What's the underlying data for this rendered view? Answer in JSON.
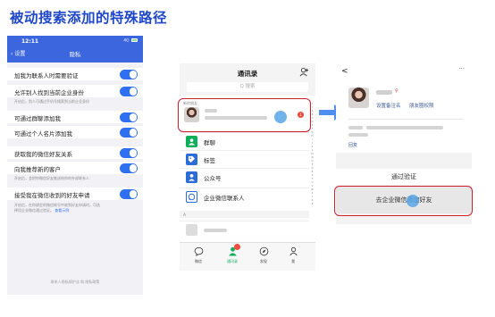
{
  "page": {
    "title": "被动搜索添加的特殊路径"
  },
  "phone1": {
    "status": {
      "time": "12:11",
      "signal": "4G"
    },
    "nav": {
      "back": "设置",
      "title": "隐私"
    },
    "rows": [
      {
        "label": "加我为联系人时需要验证",
        "on": true
      },
      {
        "label": "允许别人找到当前企业身份",
        "on": true
      },
      {
        "label": "可通过群聊添加我",
        "on": true
      },
      {
        "label": "可通过个人名片添加我",
        "on": true
      },
      {
        "label": "获取我的微信好友关系",
        "on": true
      },
      {
        "label": "向我推荐新的客户",
        "on": true
      },
      {
        "label": "接受我在微信收到的好友申请",
        "on": true
      }
    ],
    "notes": {
      "n1": "开启后，别人可通过手机号搜索到当前企业身份",
      "n2": "开启后，会把你微信好友推送给你的外部联系人",
      "n3a": "开启后，在你绑定的微信帐号中收到好友申请时，可选",
      "n3b": "择用企业微信通过验证。",
      "n3c": "查看示例"
    },
    "footer": "联系人隐私保护法 和 隐私政策"
  },
  "phone2": {
    "title": "通讯录",
    "search": "Q 搜索",
    "new_friends_label": "新的朋友",
    "new_friend_badge": "1",
    "items": [
      {
        "label": "群聊",
        "icon": "group-chat-icon",
        "color": "#0fae5a"
      },
      {
        "label": "标签",
        "icon": "tag-icon",
        "color": "#2b6cd8"
      },
      {
        "label": "公众号",
        "icon": "official-account-icon",
        "color": "#2b6cd8"
      },
      {
        "label": "企业微信联系人",
        "icon": "wecom-contacts-icon",
        "color": "#2b6cd8"
      }
    ],
    "section_letter": "A",
    "index_letters": [
      "↑",
      "☆",
      "A",
      "B",
      "C",
      "D",
      "E",
      "F",
      "G",
      "H",
      "I",
      "J",
      "K",
      "L",
      "M",
      "N",
      "O",
      "P",
      "Q",
      "R",
      "S",
      "T",
      "U",
      "V",
      "W",
      "X",
      "Y",
      "Z",
      "#"
    ],
    "tabs": [
      {
        "label": "微信",
        "icon": "chat-bubble-icon",
        "active": false
      },
      {
        "label": "通讯录",
        "icon": "contacts-icon",
        "active": true
      },
      {
        "label": "发现",
        "icon": "compass-icon",
        "active": false
      },
      {
        "label": "我",
        "icon": "person-icon",
        "active": false
      }
    ]
  },
  "phone3": {
    "back": "<",
    "more": "···",
    "gender": "♀",
    "links": {
      "set_remark": "设置备注名",
      "moments_permission": "朋友圈权限"
    },
    "reply": "回复",
    "verify_label": "通过验证",
    "add_button": "去企业微信添加好友"
  },
  "colors": {
    "title_blue": "#1f47c8",
    "toggle_blue": "#2f6ff2",
    "highlight_red": "#d11e2d",
    "arrow_blue": "#4f8ff0",
    "wechat_green": "#0fae5a"
  }
}
